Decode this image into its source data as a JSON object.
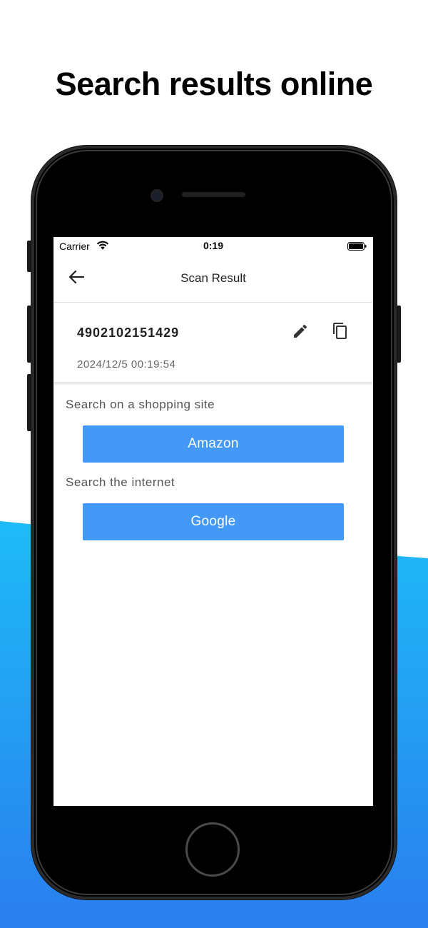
{
  "headline": "Search results online",
  "status_bar": {
    "carrier": "Carrier",
    "time": "0:19"
  },
  "app_bar": {
    "title": "Scan Result",
    "back_icon": "arrow-left-icon"
  },
  "result": {
    "code": "4902102151429",
    "timestamp": "2024/12/5 00:19:54",
    "edit_icon": "pencil-icon",
    "copy_icon": "copy-icon"
  },
  "shopping": {
    "label": "Search on a shopping site",
    "button": "Amazon"
  },
  "internet": {
    "label": "Search the internet",
    "button": "Google"
  },
  "colors": {
    "accent": "#4499f7",
    "background_gradient_top": "#1fb6f6",
    "background_gradient_bottom": "#2c83ef"
  }
}
